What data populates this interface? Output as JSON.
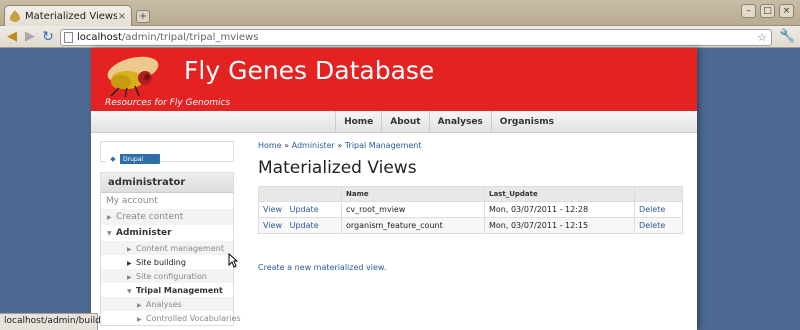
{
  "browser": {
    "tab_title": "Materialized Views | Fl...",
    "tab_close": "×",
    "new_tab": "+",
    "window_buttons": [
      "–",
      "□",
      "×"
    ],
    "url_host": "localhost",
    "url_path": "/admin/tripal/tripal_mviews",
    "status_url": "localhost/admin/build"
  },
  "site": {
    "name": "Fly Genes Database",
    "slogan": "Resources for Fly Genomics",
    "banner_color": "#e52222",
    "primary_links": [
      "Home",
      "About",
      "Analyses",
      "Organisms"
    ]
  },
  "sidebar": {
    "powered_by": "Drupal",
    "user_block_title": "administrator",
    "menu": [
      {
        "label": "My account",
        "level": 0
      },
      {
        "label": "Create content",
        "level": 1
      },
      {
        "label": "Administer",
        "level": 1
      },
      {
        "label": "Content management",
        "level": 2
      },
      {
        "label": "Site building",
        "level": 2
      },
      {
        "label": "Site configuration",
        "level": 2
      },
      {
        "label": "Tripal Management",
        "level": 2
      },
      {
        "label": "Analyses",
        "level": 3
      },
      {
        "label": "Controlled Vocabularies",
        "level": 3
      }
    ]
  },
  "main": {
    "breadcrumb": [
      "Home",
      "Administer",
      "Tripal Management"
    ],
    "breadcrumb_sep": " » ",
    "title": "Materialized Views",
    "table": {
      "headers": [
        "",
        "Name",
        "Last_Update",
        ""
      ],
      "rows": [
        {
          "view": "View",
          "update": "Update",
          "name": "cv_root_mview",
          "last_update": "Mon, 03/07/2011 - 12:28",
          "delete": "Delete"
        },
        {
          "view": "View",
          "update": "Update",
          "name": "organism_feature_count",
          "last_update": "Mon, 03/07/2011 - 12:15",
          "delete": "Delete"
        }
      ]
    },
    "create_link": "Create a new materialized view."
  }
}
